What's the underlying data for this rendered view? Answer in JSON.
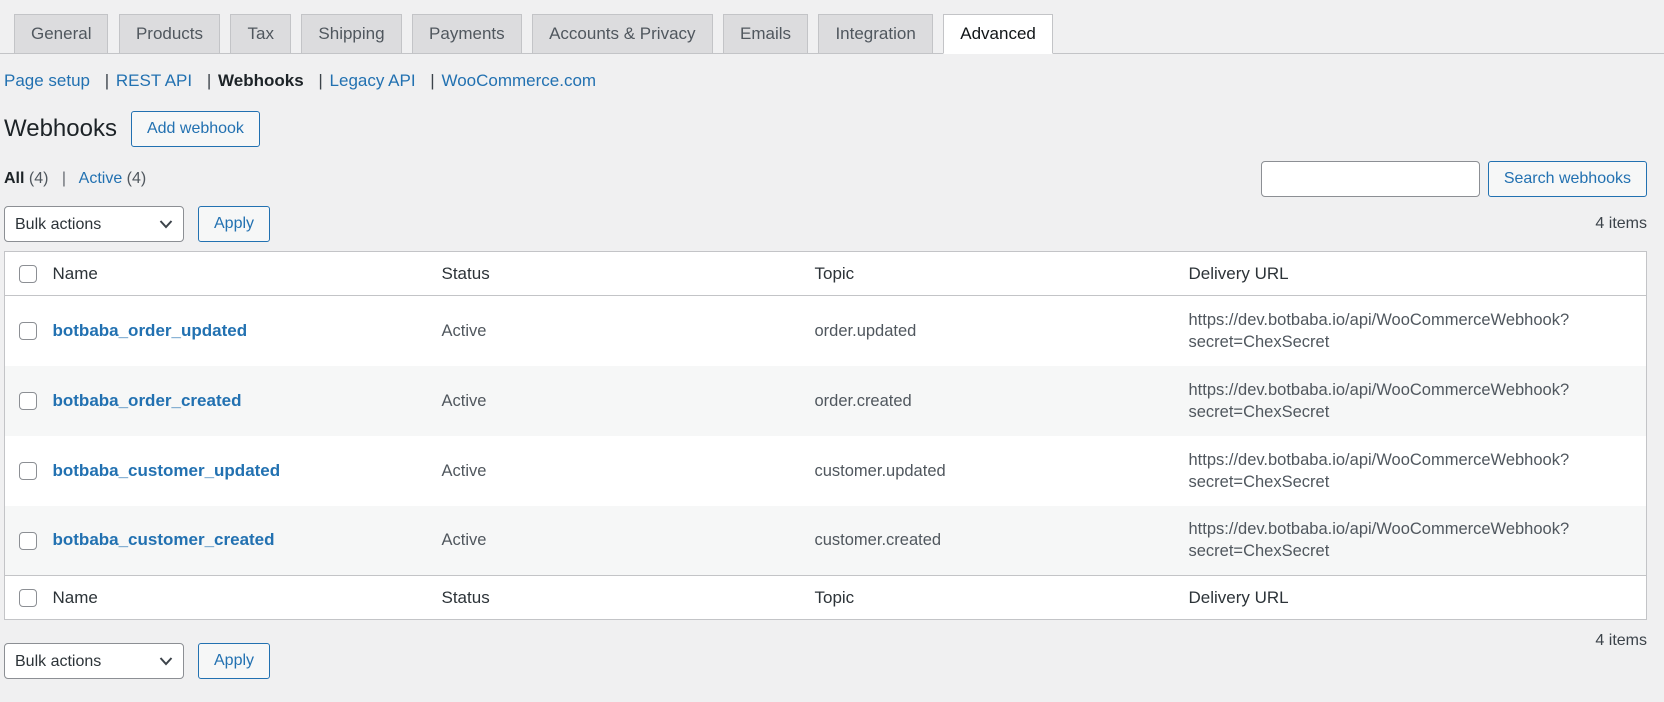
{
  "colors": {
    "accent": "#2271b1",
    "page_background": "#f0f0f1",
    "tab_background": "#dcdcde",
    "border": "#c3c4c7",
    "row_stripe": "#f6f7f7",
    "muted_text": "#50575e"
  },
  "tabs": {
    "items": [
      {
        "label": "General"
      },
      {
        "label": "Products"
      },
      {
        "label": "Tax"
      },
      {
        "label": "Shipping"
      },
      {
        "label": "Payments"
      },
      {
        "label": "Accounts & Privacy"
      },
      {
        "label": "Emails"
      },
      {
        "label": "Integration"
      },
      {
        "label": "Advanced",
        "active": true
      }
    ]
  },
  "subnav": {
    "items": [
      {
        "sep": "",
        "label": "Page setup"
      },
      {
        "sep": "|",
        "label": "REST API"
      },
      {
        "sep": "|",
        "label": "Webhooks",
        "current": true
      },
      {
        "sep": "|",
        "label": "Legacy API"
      },
      {
        "sep": "|",
        "label": "WooCommerce.com"
      }
    ]
  },
  "header": {
    "title": "Webhooks",
    "add_button_label": "Add webhook"
  },
  "views": {
    "items": [
      {
        "sep": "",
        "label": "All",
        "count": "(4)",
        "current": true
      },
      {
        "sep": "|",
        "label": "Active",
        "count": "(4)"
      }
    ]
  },
  "search": {
    "value": "",
    "button_label": "Search webhooks"
  },
  "bulk_actions": {
    "selected_option": "Bulk actions",
    "apply_label": "Apply"
  },
  "pagination": {
    "items_count": "4 items"
  },
  "table": {
    "headers": {
      "name": "Name",
      "status": "Status",
      "topic": "Topic",
      "delivery_url": "Delivery URL"
    },
    "rows": [
      {
        "name": "botbaba_order_updated",
        "status": "Active",
        "topic": "order.updated",
        "delivery_url": "https://dev.botbaba.io/api/WooCommerceWebhook?secret=ChexSecret"
      },
      {
        "name": "botbaba_order_created",
        "status": "Active",
        "topic": "order.created",
        "delivery_url": "https://dev.botbaba.io/api/WooCommerceWebhook?secret=ChexSecret"
      },
      {
        "name": "botbaba_customer_updated",
        "status": "Active",
        "topic": "customer.updated",
        "delivery_url": "https://dev.botbaba.io/api/WooCommerceWebhook?secret=ChexSecret"
      },
      {
        "name": "botbaba_customer_created",
        "status": "Active",
        "topic": "customer.created",
        "delivery_url": "https://dev.botbaba.io/api/WooCommerceWebhook?secret=ChexSecret"
      }
    ]
  }
}
